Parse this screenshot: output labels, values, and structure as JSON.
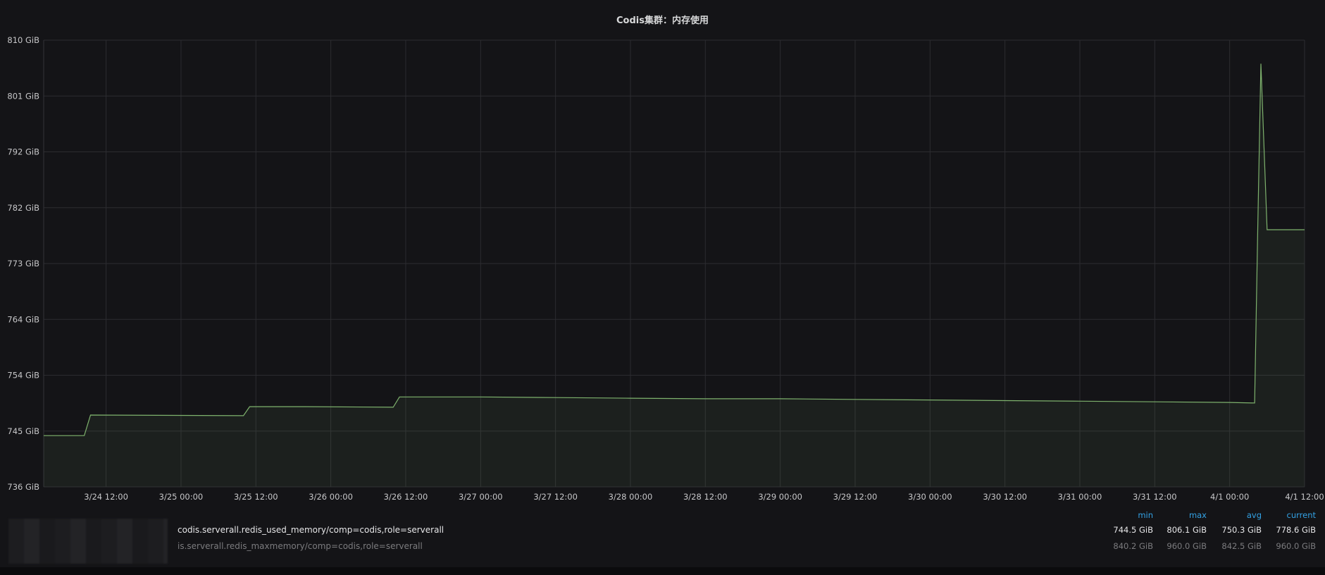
{
  "panel": {
    "title": "Codis集群：内存使用"
  },
  "chart_data": {
    "type": "area",
    "title": "Codis集群：内存使用",
    "xlabel": "",
    "ylabel": "",
    "unit": "GiB",
    "grid": true,
    "ylim": [
      736,
      810
    ],
    "yticks": [
      {
        "value": 736,
        "label": "736 GiB"
      },
      {
        "value": 745.25,
        "label": "745 GiB"
      },
      {
        "value": 754.5,
        "label": "754 GiB"
      },
      {
        "value": 763.75,
        "label": "764 GiB"
      },
      {
        "value": 773,
        "label": "773 GiB"
      },
      {
        "value": 782.25,
        "label": "782 GiB"
      },
      {
        "value": 791.5,
        "label": "792 GiB"
      },
      {
        "value": 800.75,
        "label": "801 GiB"
      },
      {
        "value": 810,
        "label": "810 GiB"
      }
    ],
    "xlim": [
      "2020-03-24T02:00",
      "2020-04-01T12:00"
    ],
    "xticks": [
      {
        "t": "2020-03-24T12:00",
        "label": "3/24 12:00"
      },
      {
        "t": "2020-03-25T00:00",
        "label": "3/25 00:00"
      },
      {
        "t": "2020-03-25T12:00",
        "label": "3/25 12:00"
      },
      {
        "t": "2020-03-26T00:00",
        "label": "3/26 00:00"
      },
      {
        "t": "2020-03-26T12:00",
        "label": "3/26 12:00"
      },
      {
        "t": "2020-03-27T00:00",
        "label": "3/27 00:00"
      },
      {
        "t": "2020-03-27T12:00",
        "label": "3/27 12:00"
      },
      {
        "t": "2020-03-28T00:00",
        "label": "3/28 00:00"
      },
      {
        "t": "2020-03-28T12:00",
        "label": "3/28 12:00"
      },
      {
        "t": "2020-03-29T00:00",
        "label": "3/29 00:00"
      },
      {
        "t": "2020-03-29T12:00",
        "label": "3/29 12:00"
      },
      {
        "t": "2020-03-30T00:00",
        "label": "3/30 00:00"
      },
      {
        "t": "2020-03-30T12:00",
        "label": "3/30 12:00"
      },
      {
        "t": "2020-03-31T00:00",
        "label": "3/31 00:00"
      },
      {
        "t": "2020-03-31T12:00",
        "label": "3/31 12:00"
      },
      {
        "t": "2020-04-01T00:00",
        "label": "4/1 00:00"
      },
      {
        "t": "2020-04-01T12:00",
        "label": "4/1 12:00"
      }
    ],
    "series": [
      {
        "name": "codis.serverall.redis_used_memory/comp=codis,role=serverall",
        "color": "#7eb26d",
        "points": [
          [
            "2020-03-24T02:00",
            744.5
          ],
          [
            "2020-03-24T08:30",
            744.5
          ],
          [
            "2020-03-24T09:30",
            747.9
          ],
          [
            "2020-03-25T10:00",
            747.8
          ],
          [
            "2020-03-25T11:00",
            749.3
          ],
          [
            "2020-03-25T20:00",
            749.3
          ],
          [
            "2020-03-26T10:00",
            749.2
          ],
          [
            "2020-03-26T11:00",
            750.9
          ],
          [
            "2020-03-27T00:00",
            750.9
          ],
          [
            "2020-03-27T12:00",
            750.8
          ],
          [
            "2020-03-28T00:00",
            750.7
          ],
          [
            "2020-03-28T12:00",
            750.6
          ],
          [
            "2020-03-29T00:00",
            750.6
          ],
          [
            "2020-03-29T12:00",
            750.5
          ],
          [
            "2020-03-30T00:00",
            750.4
          ],
          [
            "2020-03-30T12:00",
            750.3
          ],
          [
            "2020-03-31T00:00",
            750.2
          ],
          [
            "2020-03-31T12:00",
            750.1
          ],
          [
            "2020-04-01T00:00",
            750.0
          ],
          [
            "2020-04-01T04:00",
            749.9
          ],
          [
            "2020-04-01T04:30",
            778.6
          ],
          [
            "2020-04-01T05:00",
            806.1
          ],
          [
            "2020-04-01T06:00",
            778.6
          ],
          [
            "2020-04-01T12:00",
            778.6
          ]
        ]
      },
      {
        "name": "is.serverall.redis_maxmemory/comp=codis,role=serverall",
        "color": "#eab839",
        "points": []
      }
    ],
    "legend": {
      "placement": "bottom",
      "columns": [
        "min",
        "max",
        "avg",
        "current"
      ],
      "rows": [
        {
          "name": "codis.serverall.redis_used_memory/comp=codis,role=serverall",
          "min": "744.5 GiB",
          "max": "806.1 GiB",
          "avg": "750.3 GiB",
          "current": "778.6 GiB"
        },
        {
          "name": "is.serverall.redis_maxmemory/comp=codis,role=serverall",
          "min": "840.2 GiB",
          "max": "960.0 GiB",
          "avg": "842.5 GiB",
          "current": "960.0 GiB"
        }
      ]
    }
  }
}
